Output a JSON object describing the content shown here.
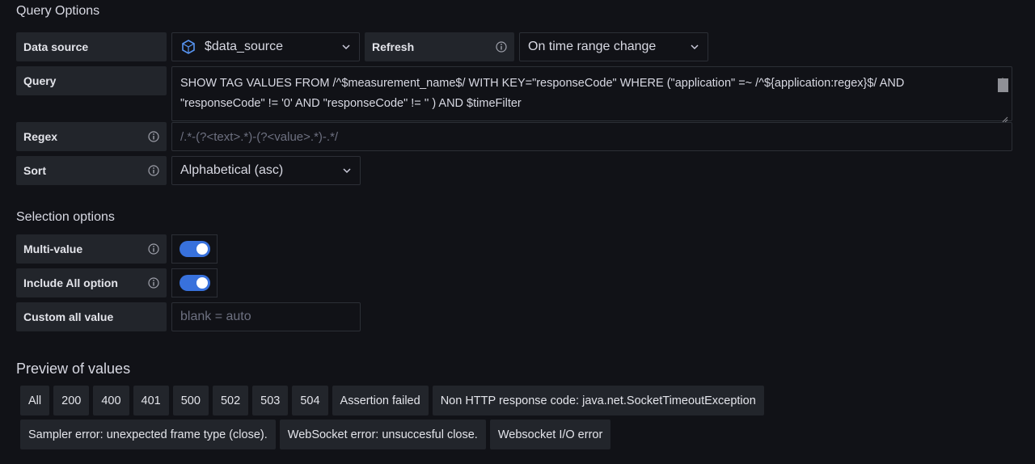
{
  "query_options": {
    "title": "Query Options",
    "data_source": {
      "label": "Data source",
      "value": "$data_source",
      "icon": "database-icon"
    },
    "refresh": {
      "label": "Refresh",
      "value": "On time range change"
    },
    "query": {
      "label": "Query",
      "line1": "SHOW TAG VALUES FROM /^$measurement_name$/ WITH KEY=\"responseCode\" WHERE (\"application\" =~ /^${application:regex}$/  AND",
      "line2": "\"responseCode\" != '0'  AND \"responseCode\" != '' ) AND $timeFilter"
    },
    "regex": {
      "label": "Regex",
      "placeholder": "/.*-(?<text>.*)-(?<value>.*)-.*/"
    },
    "sort": {
      "label": "Sort",
      "value": "Alphabetical (asc)"
    }
  },
  "selection_options": {
    "title": "Selection options",
    "multi_value": {
      "label": "Multi-value",
      "enabled": true
    },
    "include_all": {
      "label": "Include All option",
      "enabled": true
    },
    "custom_all": {
      "label": "Custom all value",
      "placeholder": "blank = auto"
    }
  },
  "preview": {
    "title": "Preview of values",
    "row1": [
      "All",
      "200",
      "400",
      "401",
      "500",
      "502",
      "503",
      "504",
      "Assertion failed",
      "Non HTTP response code: java.net.SocketTimeoutException"
    ],
    "row2": [
      "Sampler error: unexpected frame type (close).",
      "WebSocket error: unsuccesful close.",
      "Websocket I/O error"
    ]
  },
  "colors": {
    "background": "#111217",
    "label_bg": "#22252b",
    "toggle_on": "#3871dc"
  }
}
